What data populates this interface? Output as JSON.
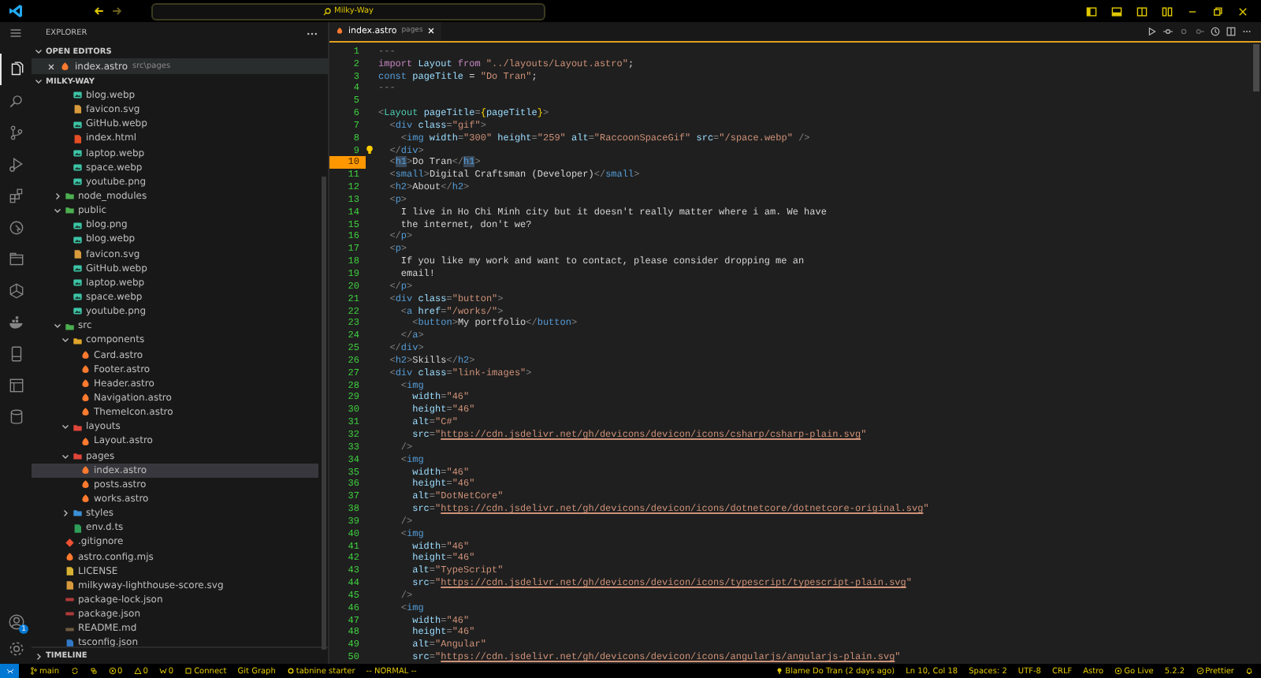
{
  "title_bar": {
    "search": "Milky-Way"
  },
  "activity_bar": {
    "items": [
      {
        "selected": true
      },
      {
        "selected": false
      },
      {
        "selected": false
      },
      {
        "selected": false
      },
      {
        "selected": false
      },
      {
        "selected": false
      },
      {
        "selected": false
      },
      {
        "selected": false
      },
      {
        "selected": false
      },
      {
        "selected": false
      },
      {
        "selected": false
      },
      {
        "selected": false
      }
    ],
    "accounts_badge": "1"
  },
  "sidebar": {
    "title": "EXPLORER",
    "open_editors": {
      "title": "OPEN EDITORS",
      "items": [
        {
          "name": "index.astro",
          "path": "src\\pages",
          "kind": "astro"
        }
      ]
    },
    "workspace": "MILKY-WAY",
    "tree": [
      {
        "children": [
          {
            "label": "blog.webp",
            "kind": "image",
            "selected": false
          },
          {
            "label": "favicon.svg",
            "kind": "svg",
            "selected": false
          },
          {
            "label": "GitHub.webp",
            "kind": "image",
            "selected": false
          },
          {
            "label": "index.html",
            "kind": "html",
            "selected": false
          },
          {
            "label": "laptop.webp",
            "kind": "image",
            "selected": false
          },
          {
            "label": "space.webp",
            "kind": "image",
            "selected": false
          },
          {
            "label": "youtube.png",
            "kind": "image",
            "selected": false
          }
        ]
      },
      {
        "label": "node_modules",
        "kind": "folder-green",
        "expanded": false,
        "selected": false
      },
      {
        "label": "public",
        "kind": "folder-green",
        "expanded": true,
        "selected": false,
        "children": [
          {
            "label": "blog.png",
            "kind": "image",
            "selected": false
          },
          {
            "label": "blog.webp",
            "kind": "image",
            "selected": false
          },
          {
            "label": "favicon.svg",
            "kind": "svg",
            "selected": false
          },
          {
            "label": "GitHub.webp",
            "kind": "image",
            "selected": false
          },
          {
            "label": "laptop.webp",
            "kind": "image",
            "selected": false
          },
          {
            "label": "space.webp",
            "kind": "image",
            "selected": false
          },
          {
            "label": "youtube.png",
            "kind": "image",
            "selected": false
          }
        ]
      },
      {
        "label": "src",
        "kind": "folder-green",
        "expanded": true,
        "selected": false,
        "children": [
          {
            "label": "components",
            "kind": "folder-yellow",
            "expanded": true,
            "selected": false,
            "children": [
              {
                "label": "Card.astro",
                "kind": "astro",
                "selected": false
              },
              {
                "label": "Footer.astro",
                "kind": "astro",
                "selected": false
              },
              {
                "label": "Header.astro",
                "kind": "astro",
                "selected": false
              },
              {
                "label": "Navigation.astro",
                "kind": "astro",
                "selected": false
              },
              {
                "label": "ThemeIcon.astro",
                "kind": "astro",
                "selected": false
              }
            ]
          },
          {
            "label": "layouts",
            "kind": "folder-red",
            "expanded": true,
            "selected": false,
            "children": [
              {
                "label": "Layout.astro",
                "kind": "astro",
                "selected": false
              }
            ]
          },
          {
            "label": "pages",
            "kind": "folder-red",
            "expanded": true,
            "selected": false,
            "children": [
              {
                "label": "index.astro",
                "kind": "astro",
                "selected": true
              },
              {
                "label": "posts.astro",
                "kind": "astro",
                "selected": false
              },
              {
                "label": "works.astro",
                "kind": "astro",
                "selected": false
              }
            ]
          },
          {
            "label": "styles",
            "kind": "folder-blue",
            "expanded": false,
            "selected": false
          },
          {
            "label": "env.d.ts",
            "kind": "ts",
            "selected": false
          }
        ]
      },
      {
        "label": ".gitignore",
        "kind": "git",
        "selected": false
      },
      {
        "label": "astro.config.mjs",
        "kind": "astro",
        "selected": false
      },
      {
        "label": "LICENSE",
        "kind": "license",
        "selected": false
      },
      {
        "label": "milkyway-lighthouse-score.svg",
        "kind": "svg",
        "selected": false
      },
      {
        "label": "package-lock.json",
        "kind": "json",
        "selected": false
      },
      {
        "label": "package.json",
        "kind": "json",
        "selected": false
      },
      {
        "label": "README.md",
        "kind": "md",
        "selected": false
      },
      {
        "label": "tsconfig.json",
        "kind": "tsconfig",
        "selected": false
      }
    ],
    "timeline": "TIMELINE"
  },
  "editor": {
    "tab": {
      "name": "index.astro",
      "path": "pages"
    },
    "lines": [
      {
        "number": "1",
        "current": false,
        "lightbulb": false,
        "tokens": [
          {
            "kind": "fence",
            "text": "---"
          }
        ]
      },
      {
        "number": "2",
        "current": false,
        "lightbulb": false,
        "tokens": [
          {
            "kind": "kw",
            "text": "import"
          },
          {
            "kind": "var",
            "text": " Layout "
          },
          {
            "kind": "kw",
            "text": "from"
          },
          {
            "kind": "str",
            "text": " \"../layouts/Layout.astro\""
          },
          {
            "kind": "text",
            "text": ";"
          }
        ]
      },
      {
        "number": "3",
        "current": false,
        "lightbulb": false,
        "tokens": [
          {
            "kind": "decl",
            "text": "const"
          },
          {
            "kind": "var",
            "text": " pageTitle"
          },
          {
            "kind": "text",
            "text": " = "
          },
          {
            "kind": "str",
            "text": "\"Do Tran\""
          },
          {
            "kind": "text",
            "text": ";"
          }
        ]
      },
      {
        "number": "4",
        "current": false,
        "lightbulb": false,
        "tokens": [
          {
            "kind": "fence",
            "text": "---"
          }
        ]
      },
      {
        "number": "5",
        "current": false,
        "lightbulb": false
      },
      {
        "number": "6",
        "current": false,
        "lightbulb": false,
        "tokens": [
          {
            "kind": "punct",
            "text": "<"
          },
          {
            "kind": "comp",
            "text": "Layout"
          },
          {
            "kind": "attr",
            "text": " pageTitle"
          },
          {
            "kind": "punct",
            "text": "="
          },
          {
            "kind": "brace",
            "text": "{"
          },
          {
            "kind": "var",
            "text": "pageTitle"
          },
          {
            "kind": "brace",
            "text": "}"
          },
          {
            "kind": "punct",
            "text": ">"
          }
        ]
      },
      {
        "number": "7",
        "current": false,
        "lightbulb": false,
        "tokens": [
          {
            "kind": "punct",
            "text": "  <"
          },
          {
            "kind": "tag",
            "text": "div"
          },
          {
            "kind": "attr",
            "text": " class"
          },
          {
            "kind": "punct",
            "text": "="
          },
          {
            "kind": "str",
            "text": "\"gif\""
          },
          {
            "kind": "punct",
            "text": ">"
          }
        ]
      },
      {
        "number": "8",
        "current": false,
        "lightbulb": false,
        "tokens": [
          {
            "kind": "punct",
            "text": "    <"
          },
          {
            "kind": "tag",
            "text": "img"
          },
          {
            "kind": "attr",
            "text": " width"
          },
          {
            "kind": "punct",
            "text": "="
          },
          {
            "kind": "str",
            "text": "\"300\""
          },
          {
            "kind": "attr",
            "text": " height"
          },
          {
            "kind": "punct",
            "text": "="
          },
          {
            "kind": "str",
            "text": "\"259\""
          },
          {
            "kind": "attr",
            "text": " alt"
          },
          {
            "kind": "punct",
            "text": "="
          },
          {
            "kind": "str",
            "text": "\"RaccoonSpaceGif\""
          },
          {
            "kind": "attr",
            "text": " src"
          },
          {
            "kind": "punct",
            "text": "="
          },
          {
            "kind": "str",
            "text": "\"/space.webp\""
          },
          {
            "kind": "punct",
            "text": " />"
          }
        ]
      },
      {
        "number": "9",
        "current": false,
        "lightbulb": true,
        "tokens": [
          {
            "kind": "punct",
            "text": "  </"
          },
          {
            "kind": "tag",
            "text": "div"
          },
          {
            "kind": "punct",
            "text": ">"
          }
        ]
      },
      {
        "number": "10",
        "current": true,
        "lightbulb": false,
        "tokens": [
          {
            "kind": "punct",
            "text": "  <"
          },
          {
            "kind": "match",
            "text": "h1"
          },
          {
            "kind": "punct",
            "text": ">"
          },
          {
            "kind": "text",
            "text": "Do Tran"
          },
          {
            "kind": "punct",
            "text": "</"
          },
          {
            "kind": "match",
            "text": "h1"
          },
          {
            "kind": "punct",
            "text": ">"
          }
        ]
      },
      {
        "number": "11",
        "current": false,
        "lightbulb": false,
        "tokens": [
          {
            "kind": "punct",
            "text": "  <"
          },
          {
            "kind": "tag",
            "text": "small"
          },
          {
            "kind": "punct",
            "text": ">"
          },
          {
            "kind": "text",
            "text": "Digital Craftsman (Developer)"
          },
          {
            "kind": "punct",
            "text": "</"
          },
          {
            "kind": "tag",
            "text": "small"
          },
          {
            "kind": "punct",
            "text": ">"
          }
        ]
      },
      {
        "number": "12",
        "current": false,
        "lightbulb": false,
        "tokens": [
          {
            "kind": "punct",
            "text": "  <"
          },
          {
            "kind": "tag",
            "text": "h2"
          },
          {
            "kind": "punct",
            "text": ">"
          },
          {
            "kind": "text",
            "text": "About"
          },
          {
            "kind": "punct",
            "text": "</"
          },
          {
            "kind": "tag",
            "text": "h2"
          },
          {
            "kind": "punct",
            "text": ">"
          }
        ]
      },
      {
        "number": "13",
        "current": false,
        "lightbulb": false,
        "tokens": [
          {
            "kind": "punct",
            "text": "  <"
          },
          {
            "kind": "tag",
            "text": "p"
          },
          {
            "kind": "punct",
            "text": ">"
          }
        ]
      },
      {
        "number": "14",
        "current": false,
        "lightbulb": false,
        "tokens": [
          {
            "kind": "text",
            "text": "    I live in Ho Chi Minh city but it doesn't really matter where i am. We have"
          }
        ]
      },
      {
        "number": "15",
        "current": false,
        "lightbulb": false,
        "tokens": [
          {
            "kind": "text",
            "text": "    the internet, don't we?"
          }
        ]
      },
      {
        "number": "16",
        "current": false,
        "lightbulb": false,
        "tokens": [
          {
            "kind": "punct",
            "text": "  </"
          },
          {
            "kind": "tag",
            "text": "p"
          },
          {
            "kind": "punct",
            "text": ">"
          }
        ]
      },
      {
        "number": "17",
        "current": false,
        "lightbulb": false,
        "tokens": [
          {
            "kind": "punct",
            "text": "  <"
          },
          {
            "kind": "tag",
            "text": "p"
          },
          {
            "kind": "punct",
            "text": ">"
          }
        ]
      },
      {
        "number": "18",
        "current": false,
        "lightbulb": false,
        "tokens": [
          {
            "kind": "text",
            "text": "    If you like my work and want to contact, please consider dropping me an"
          }
        ]
      },
      {
        "number": "19",
        "current": false,
        "lightbulb": false,
        "tokens": [
          {
            "kind": "text",
            "text": "    email!"
          }
        ]
      },
      {
        "number": "20",
        "current": false,
        "lightbulb": false,
        "tokens": [
          {
            "kind": "punct",
            "text": "  </"
          },
          {
            "kind": "tag",
            "text": "p"
          },
          {
            "kind": "punct",
            "text": ">"
          }
        ]
      },
      {
        "number": "21",
        "current": false,
        "lightbulb": false,
        "tokens": [
          {
            "kind": "punct",
            "text": "  <"
          },
          {
            "kind": "tag",
            "text": "div"
          },
          {
            "kind": "attr",
            "text": " class"
          },
          {
            "kind": "punct",
            "text": "="
          },
          {
            "kind": "str",
            "text": "\"button\""
          },
          {
            "kind": "punct",
            "text": ">"
          }
        ]
      },
      {
        "number": "22",
        "current": false,
        "lightbulb": false,
        "tokens": [
          {
            "kind": "punct",
            "text": "    <"
          },
          {
            "kind": "tag",
            "text": "a"
          },
          {
            "kind": "attr",
            "text": " href"
          },
          {
            "kind": "punct",
            "text": "="
          },
          {
            "kind": "str",
            "text": "\"/works/\""
          },
          {
            "kind": "punct",
            "text": ">"
          }
        ]
      },
      {
        "number": "23",
        "current": false,
        "lightbulb": false,
        "tokens": [
          {
            "kind": "punct",
            "text": "      <"
          },
          {
            "kind": "tag",
            "text": "button"
          },
          {
            "kind": "punct",
            "text": ">"
          },
          {
            "kind": "text",
            "text": "My portfolio"
          },
          {
            "kind": "punct",
            "text": "</"
          },
          {
            "kind": "tag",
            "text": "button"
          },
          {
            "kind": "punct",
            "text": ">"
          }
        ]
      },
      {
        "number": "24",
        "current": false,
        "lightbulb": false,
        "tokens": [
          {
            "kind": "punct",
            "text": "    </"
          },
          {
            "kind": "tag",
            "text": "a"
          },
          {
            "kind": "punct",
            "text": ">"
          }
        ]
      },
      {
        "number": "25",
        "current": false,
        "lightbulb": false,
        "tokens": [
          {
            "kind": "punct",
            "text": "  </"
          },
          {
            "kind": "tag",
            "text": "div"
          },
          {
            "kind": "punct",
            "text": ">"
          }
        ]
      },
      {
        "number": "26",
        "current": false,
        "lightbulb": false,
        "tokens": [
          {
            "kind": "punct",
            "text": "  <"
          },
          {
            "kind": "tag",
            "text": "h2"
          },
          {
            "kind": "punct",
            "text": ">"
          },
          {
            "kind": "text",
            "text": "Skills"
          },
          {
            "kind": "punct",
            "text": "</"
          },
          {
            "kind": "tag",
            "text": "h2"
          },
          {
            "kind": "punct",
            "text": ">"
          }
        ]
      },
      {
        "number": "27",
        "current": false,
        "lightbulb": false,
        "tokens": [
          {
            "kind": "punct",
            "text": "  <"
          },
          {
            "kind": "tag",
            "text": "div"
          },
          {
            "kind": "attr",
            "text": " class"
          },
          {
            "kind": "punct",
            "text": "="
          },
          {
            "kind": "str",
            "text": "\"link-images\""
          },
          {
            "kind": "punct",
            "text": ">"
          }
        ]
      },
      {
        "number": "28",
        "current": false,
        "lightbulb": false,
        "tokens": [
          {
            "kind": "punct",
            "text": "    <"
          },
          {
            "kind": "tag",
            "text": "img"
          }
        ]
      },
      {
        "number": "29",
        "current": false,
        "lightbulb": false,
        "tokens": [
          {
            "kind": "attr",
            "text": "      width"
          },
          {
            "kind": "punct",
            "text": "="
          },
          {
            "kind": "str",
            "text": "\"46\""
          }
        ]
      },
      {
        "number": "30",
        "current": false,
        "lightbulb": false,
        "tokens": [
          {
            "kind": "attr",
            "text": "      height"
          },
          {
            "kind": "punct",
            "text": "="
          },
          {
            "kind": "str",
            "text": "\"46\""
          }
        ]
      },
      {
        "number": "31",
        "current": false,
        "lightbulb": false,
        "tokens": [
          {
            "kind": "attr",
            "text": "      alt"
          },
          {
            "kind": "punct",
            "text": "="
          },
          {
            "kind": "str",
            "text": "\"C#\""
          }
        ]
      },
      {
        "number": "32",
        "current": false,
        "lightbulb": false,
        "tokens": [
          {
            "kind": "attr",
            "text": "      src"
          },
          {
            "kind": "punct",
            "text": "="
          },
          {
            "kind": "str",
            "text": "\""
          },
          {
            "kind": "link",
            "text": "https://cdn.jsdelivr.net/gh/devicons/devicon/icons/csharp/csharp-plain.svg"
          },
          {
            "kind": "str",
            "text": "\""
          }
        ]
      },
      {
        "number": "33",
        "current": false,
        "lightbulb": false,
        "tokens": [
          {
            "kind": "punct",
            "text": "    />"
          }
        ]
      },
      {
        "number": "34",
        "current": false,
        "lightbulb": false,
        "tokens": [
          {
            "kind": "punct",
            "text": "    <"
          },
          {
            "kind": "tag",
            "text": "img"
          }
        ]
      },
      {
        "number": "35",
        "current": false,
        "lightbulb": false,
        "tokens": [
          {
            "kind": "attr",
            "text": "      width"
          },
          {
            "kind": "punct",
            "text": "="
          },
          {
            "kind": "str",
            "text": "\"46\""
          }
        ]
      },
      {
        "number": "36",
        "current": false,
        "lightbulb": false,
        "tokens": [
          {
            "kind": "attr",
            "text": "      height"
          },
          {
            "kind": "punct",
            "text": "="
          },
          {
            "kind": "str",
            "text": "\"46\""
          }
        ]
      },
      {
        "number": "37",
        "current": false,
        "lightbulb": false,
        "tokens": [
          {
            "kind": "attr",
            "text": "      alt"
          },
          {
            "kind": "punct",
            "text": "="
          },
          {
            "kind": "str",
            "text": "\"DotNetCore\""
          }
        ]
      },
      {
        "number": "38",
        "current": false,
        "lightbulb": false,
        "tokens": [
          {
            "kind": "attr",
            "text": "      src"
          },
          {
            "kind": "punct",
            "text": "="
          },
          {
            "kind": "str",
            "text": "\""
          },
          {
            "kind": "link",
            "text": "https://cdn.jsdelivr.net/gh/devicons/devicon/icons/dotnetcore/dotnetcore-original.svg"
          },
          {
            "kind": "str",
            "text": "\""
          }
        ]
      },
      {
        "number": "39",
        "current": false,
        "lightbulb": false,
        "tokens": [
          {
            "kind": "punct",
            "text": "    />"
          }
        ]
      },
      {
        "number": "40",
        "current": false,
        "lightbulb": false,
        "tokens": [
          {
            "kind": "punct",
            "text": "    <"
          },
          {
            "kind": "tag",
            "text": "img"
          }
        ]
      },
      {
        "number": "41",
        "current": false,
        "lightbulb": false,
        "tokens": [
          {
            "kind": "attr",
            "text": "      width"
          },
          {
            "kind": "punct",
            "text": "="
          },
          {
            "kind": "str",
            "text": "\"46\""
          }
        ]
      },
      {
        "number": "42",
        "current": false,
        "lightbulb": false,
        "tokens": [
          {
            "kind": "attr",
            "text": "      height"
          },
          {
            "kind": "punct",
            "text": "="
          },
          {
            "kind": "str",
            "text": "\"46\""
          }
        ]
      },
      {
        "number": "43",
        "current": false,
        "lightbulb": false,
        "tokens": [
          {
            "kind": "attr",
            "text": "      alt"
          },
          {
            "kind": "punct",
            "text": "="
          },
          {
            "kind": "str",
            "text": "\"TypeScript\""
          }
        ]
      },
      {
        "number": "44",
        "current": false,
        "lightbulb": false,
        "tokens": [
          {
            "kind": "attr",
            "text": "      src"
          },
          {
            "kind": "punct",
            "text": "="
          },
          {
            "kind": "str",
            "text": "\""
          },
          {
            "kind": "link",
            "text": "https://cdn.jsdelivr.net/gh/devicons/devicon/icons/typescript/typescript-plain.svg"
          },
          {
            "kind": "str",
            "text": "\""
          }
        ]
      },
      {
        "number": "45",
        "current": false,
        "lightbulb": false,
        "tokens": [
          {
            "kind": "punct",
            "text": "    />"
          }
        ]
      },
      {
        "number": "46",
        "current": false,
        "lightbulb": false,
        "tokens": [
          {
            "kind": "punct",
            "text": "    <"
          },
          {
            "kind": "tag",
            "text": "img"
          }
        ]
      },
      {
        "number": "47",
        "current": false,
        "lightbulb": false,
        "tokens": [
          {
            "kind": "attr",
            "text": "      width"
          },
          {
            "kind": "punct",
            "text": "="
          },
          {
            "kind": "str",
            "text": "\"46\""
          }
        ]
      },
      {
        "number": "48",
        "current": false,
        "lightbulb": false,
        "tokens": [
          {
            "kind": "attr",
            "text": "      height"
          },
          {
            "kind": "punct",
            "text": "="
          },
          {
            "kind": "str",
            "text": "\"46\""
          }
        ]
      },
      {
        "number": "49",
        "current": false,
        "lightbulb": false,
        "tokens": [
          {
            "kind": "attr",
            "text": "      alt"
          },
          {
            "kind": "punct",
            "text": "="
          },
          {
            "kind": "str",
            "text": "\"Angular\""
          }
        ]
      },
      {
        "number": "50",
        "current": false,
        "lightbulb": false,
        "tokens": [
          {
            "kind": "attr",
            "text": "      src"
          },
          {
            "kind": "punct",
            "text": "="
          },
          {
            "kind": "str",
            "text": "\""
          },
          {
            "kind": "link",
            "text": "https://cdn.jsdelivr.net/gh/devicons/devicon/icons/angularjs/angularjs-plain.svg"
          },
          {
            "kind": "str",
            "text": "\""
          }
        ]
      }
    ]
  },
  "status_bar": {
    "left": [
      {
        "kind": "remote"
      },
      {
        "kind": "branch",
        "text": "main"
      },
      {
        "kind": "sync"
      },
      {
        "kind": "stack"
      },
      {
        "kind": "error",
        "text": "0"
      },
      {
        "kind": "warning",
        "text": "0"
      },
      {
        "kind": "signal",
        "text": "0"
      },
      {
        "kind": "plug",
        "text": "Connect"
      },
      {
        "kind": "plain",
        "text": "Git Graph"
      },
      {
        "kind": "tabnine",
        "text": "tabnine starter"
      },
      {
        "kind": "plain",
        "text": "-- NORMAL --"
      }
    ],
    "right": [
      {
        "kind": "bulb",
        "text": "Blame Do Tran (2 days ago)"
      },
      {
        "kind": "plain",
        "text": "Ln 10, Col 18"
      },
      {
        "kind": "plain",
        "text": "Spaces: 2"
      },
      {
        "kind": "plain",
        "text": "UTF-8"
      },
      {
        "kind": "plain",
        "text": "CRLF"
      },
      {
        "kind": "plain",
        "text": "Astro"
      },
      {
        "kind": "golive",
        "text": "Go Live"
      },
      {
        "kind": "plain",
        "text": "5.2.2"
      },
      {
        "kind": "check",
        "text": "Prettier"
      },
      {
        "kind": "bell"
      }
    ]
  }
}
